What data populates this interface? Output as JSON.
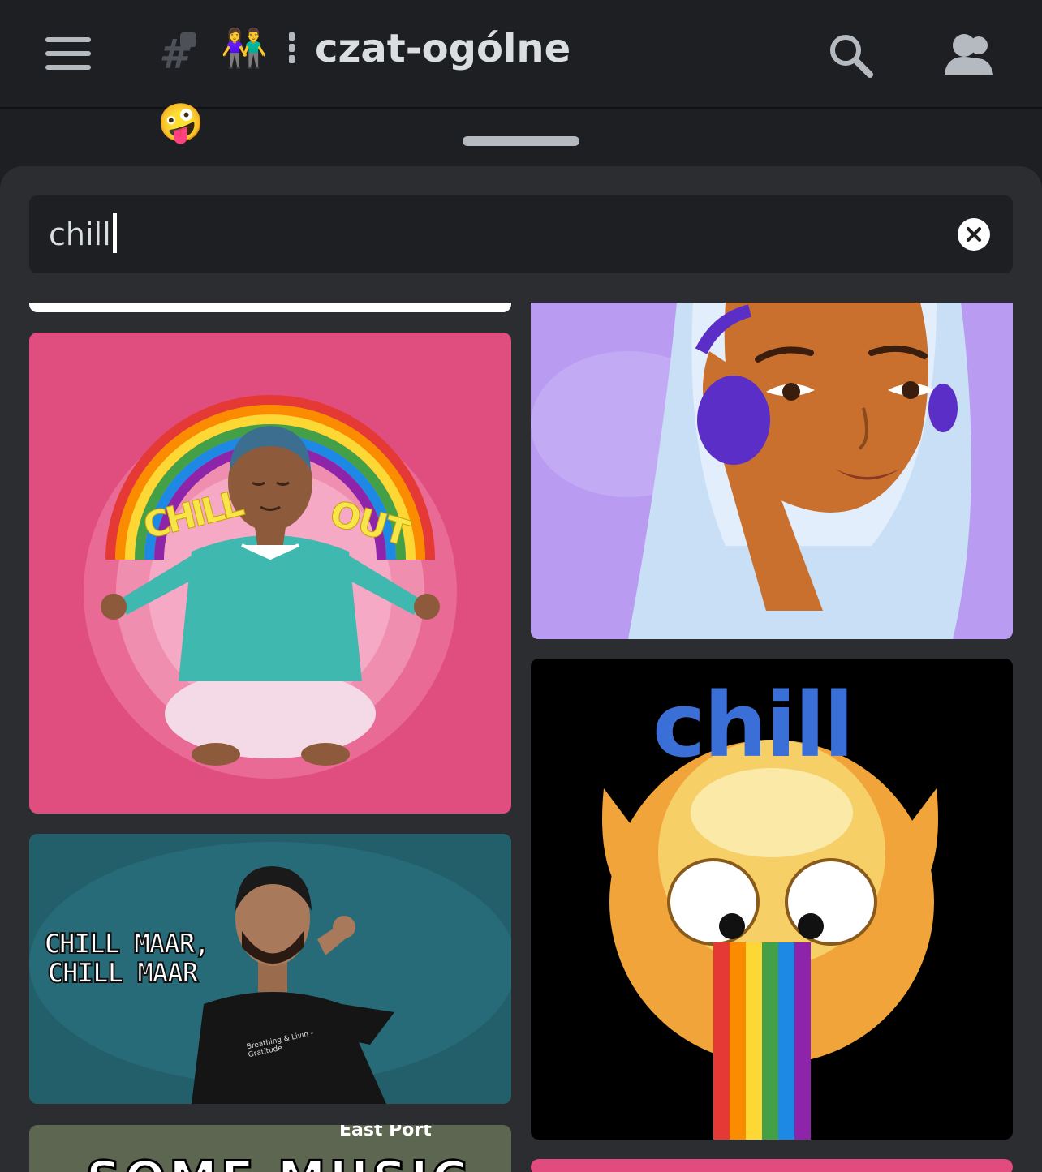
{
  "header": {
    "channel_emoji": "👫",
    "channel_name": "czat-ogólne",
    "menu_icon": "hamburger-icon",
    "search_icon": "search-icon",
    "members_icon": "members-icon"
  },
  "peek": {
    "emoji": "🤪"
  },
  "gif_picker": {
    "search_value": "chill",
    "clear_icon": "close-circle-icon"
  },
  "gifs": {
    "chill_out": {
      "word1": "CHILL",
      "word2": "OUT"
    },
    "chill_maar": {
      "line1": "CHILL MAAR,",
      "line2": "CHILL MAAR",
      "shirt": "Breathing & Livin - Gratitude"
    },
    "chill_emoji": {
      "caption": "chill"
    },
    "partial": {
      "place": "East Port",
      "big_text": "SOME MUSIC"
    }
  },
  "colors": {
    "background": "#1e1f22",
    "sheet": "#2b2d31",
    "accent_pink": "#e24b7e",
    "chill_blue": "#3a6fd8"
  }
}
